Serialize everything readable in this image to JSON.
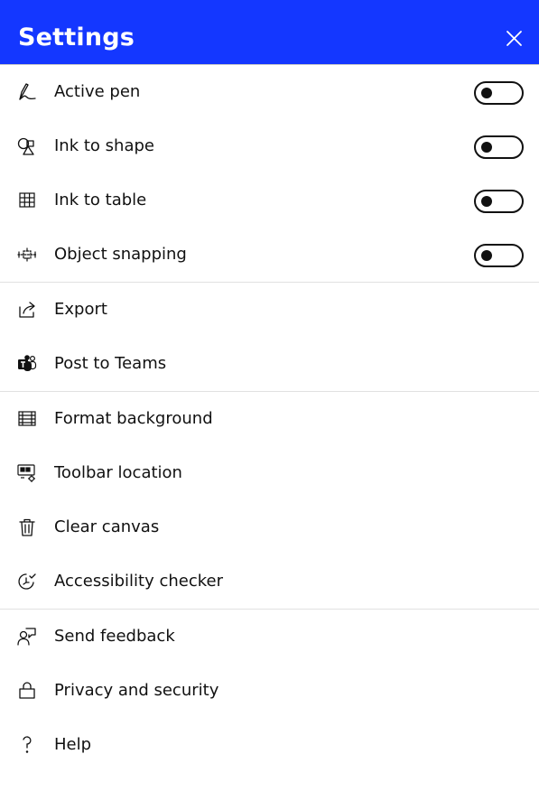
{
  "header": {
    "title": "Settings",
    "close_icon": "close-icon",
    "background_color": "#1437ff"
  },
  "sections": [
    {
      "items": [
        {
          "label": "Active pen",
          "icon": "pen-icon",
          "toggle": true,
          "on": false
        },
        {
          "label": "Ink to shape",
          "icon": "shapes-icon",
          "toggle": true,
          "on": false
        },
        {
          "label": "Ink to table",
          "icon": "table-grid-icon",
          "toggle": true,
          "on": false
        },
        {
          "label": "Object snapping",
          "icon": "snapping-icon",
          "toggle": true,
          "on": false
        }
      ]
    },
    {
      "items": [
        {
          "label": "Export",
          "icon": "export-icon"
        },
        {
          "label": "Post to Teams",
          "icon": "teams-icon"
        }
      ]
    },
    {
      "items": [
        {
          "label": "Format background",
          "icon": "background-icon"
        },
        {
          "label": "Toolbar location",
          "icon": "toolbar-location-icon"
        },
        {
          "label": "Clear canvas",
          "icon": "trash-icon"
        },
        {
          "label": "Accessibility checker",
          "icon": "accessibility-icon"
        }
      ]
    },
    {
      "items": [
        {
          "label": "Send feedback",
          "icon": "feedback-icon"
        },
        {
          "label": "Privacy and security",
          "icon": "lock-icon"
        },
        {
          "label": "Help",
          "icon": "help-icon"
        }
      ]
    }
  ]
}
